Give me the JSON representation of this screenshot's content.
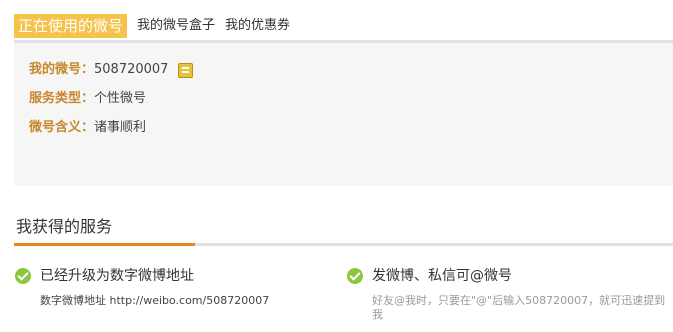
{
  "tabs": [
    {
      "label": "正在使用的微号",
      "active": true
    },
    {
      "label": "我的微号盒子",
      "active": false
    },
    {
      "label": "我的优惠券",
      "active": false
    }
  ],
  "info": {
    "rows": [
      {
        "label": "我的微号：",
        "value": "508720007",
        "icon": "weihao-badge-icon"
      },
      {
        "label": "服务类型：",
        "value": "个性微号"
      },
      {
        "label": "微号含义：",
        "value": "诸事顺利"
      }
    ]
  },
  "services": {
    "title": "我获得的服务",
    "items": [
      {
        "icon": "check-icon",
        "title": "已经升级为数字微博地址",
        "desc": "数字微博地址 http://weibo.com/508720007"
      },
      {
        "icon": "check-icon",
        "title": "发微博、私信可@微号",
        "desc": "好友@我时，只要在\"@\"后输入508720007，就可迅速提到我"
      }
    ]
  },
  "colors": {
    "tab_active_bg": "#f4c34b",
    "label_orange": "#c8872c",
    "accent_line": "#e08a1e",
    "check_green": "#8cc63f",
    "info_bg": "#f6f6f6"
  }
}
